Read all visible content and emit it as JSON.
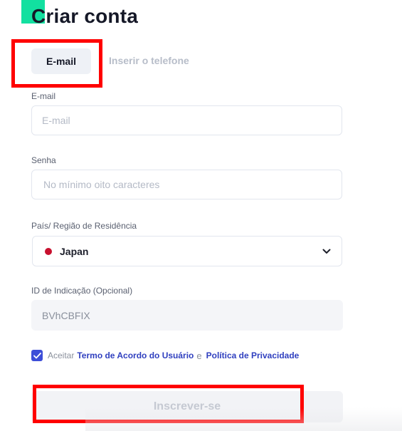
{
  "header": {
    "title": "Criar conta"
  },
  "tabs": [
    {
      "label": "E-mail",
      "active": true
    },
    {
      "label": "Inserir o telefone",
      "active": false
    }
  ],
  "form": {
    "email": {
      "label": "E-mail",
      "placeholder": "E-mail",
      "value": ""
    },
    "password": {
      "label": "Senha",
      "placeholder": "No mínimo oito caracteres",
      "value": ""
    },
    "country": {
      "label": "País/ Região de Residência",
      "selected": "Japan",
      "flag_color": "#c8102e"
    },
    "referral": {
      "label": "ID de Indicação (Opcional)",
      "value": "BVhCBFIX"
    },
    "agreement": {
      "checked": true,
      "prefix": "Aceitar",
      "terms_link": "Termo de Acordo do Usuário",
      "conjunction": "e",
      "privacy_link": "Política de Privacidade"
    },
    "submit_label": "Inscrever-se"
  },
  "colors": {
    "accent": "#12e0a0",
    "link": "#2f3fbf",
    "checkbox": "#3d4ed8",
    "highlight_box": "#ff0000"
  }
}
